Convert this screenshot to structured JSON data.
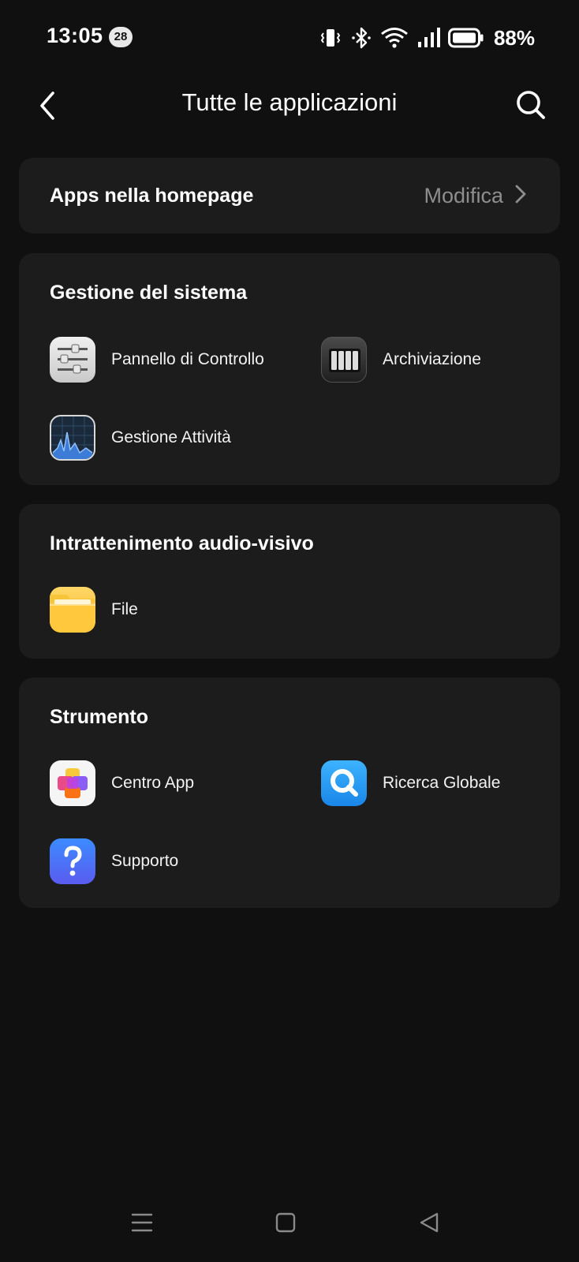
{
  "status_bar": {
    "time": "13:05",
    "notification_count": "28",
    "battery": "88%",
    "icons": [
      "vibrate-icon",
      "bluetooth-icon",
      "wifi-icon",
      "signal-icon",
      "battery-icon"
    ]
  },
  "header": {
    "title": "Tutte le applicazioni",
    "back_icon": "back-arrow-icon",
    "search_icon": "search-icon"
  },
  "homepage_apps": {
    "label": "Apps nella homepage",
    "action": "Modifica"
  },
  "sections": [
    {
      "title": "Gestione del sistema",
      "apps": [
        {
          "name": "Pannello di Controllo",
          "icon": "control-panel-icon"
        },
        {
          "name": "Archiviazione",
          "icon": "storage-icon"
        },
        {
          "name": "Gestione Attività",
          "icon": "activity-monitor-icon"
        }
      ]
    },
    {
      "title": "Intrattenimento audio-visivo",
      "apps": [
        {
          "name": "File",
          "icon": "folder-icon"
        }
      ]
    },
    {
      "title": "Strumento",
      "apps": [
        {
          "name": "Centro App",
          "icon": "app-center-icon"
        },
        {
          "name": "Ricerca Globale",
          "icon": "global-search-icon"
        },
        {
          "name": "Supporto",
          "icon": "help-icon"
        }
      ]
    }
  ],
  "nav_bar": {
    "buttons": [
      "menu-icon",
      "home-icon",
      "back-triangle-icon"
    ]
  },
  "colors": {
    "background": "#101010",
    "card": "#1c1c1c",
    "secondary_text": "#8e8e8e"
  }
}
